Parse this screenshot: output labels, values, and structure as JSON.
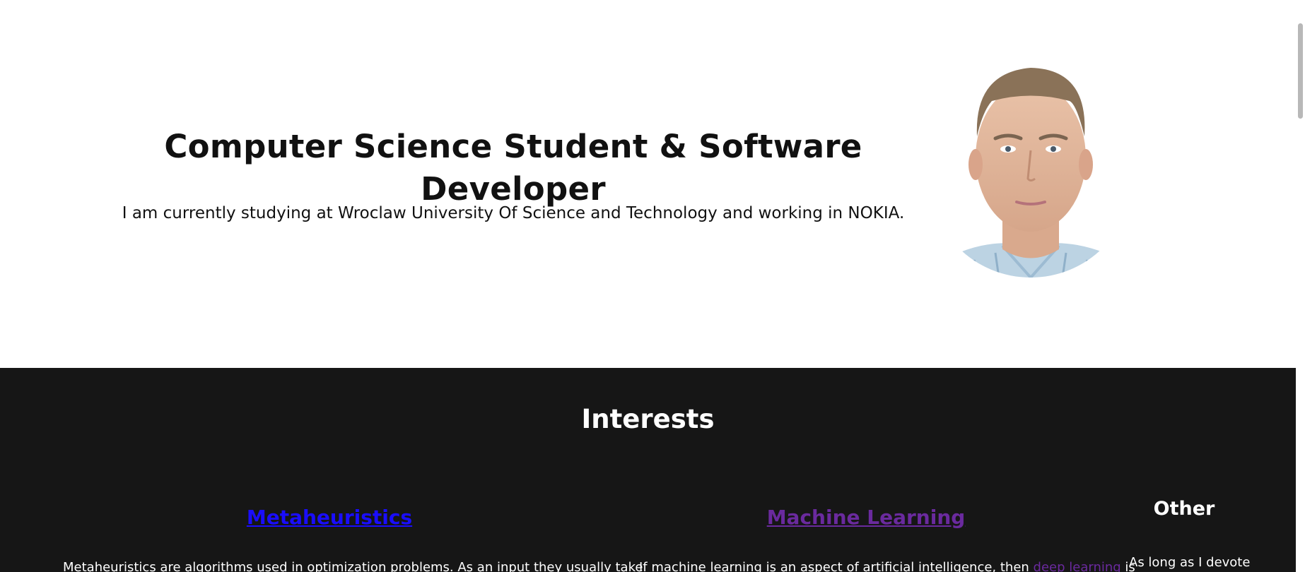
{
  "hero": {
    "title": "Computer Science Student & Software Developer",
    "subtitle": "I am currently studying at Wroclaw University Of Science and Technology and working in NOKIA.",
    "photo_icon": "profile-photo"
  },
  "interests": {
    "title": "Interests",
    "columns": [
      {
        "heading": "Metaheuristics",
        "text": "Metaheuristics are algorithms used in optimization problems. As an input they usually take"
      },
      {
        "heading": "Machine Learning",
        "text_before": "If machine learning is an aspect of artificial intelligence, then ",
        "link": "deep learning",
        "text_after": " is"
      },
      {
        "heading": "Other",
        "text": "As long as I devote"
      }
    ]
  },
  "colors": {
    "dark_section": "#161616",
    "link_unvisited": "#1a0dff",
    "link_visited": "#6a2a9e"
  }
}
